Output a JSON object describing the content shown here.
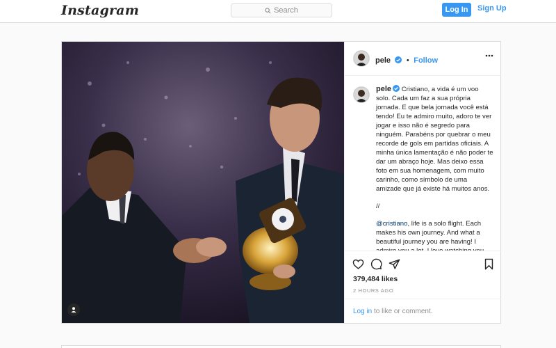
{
  "header": {
    "logo_text": "Instagram",
    "search_placeholder": "Search",
    "login_label": "Log In",
    "signup_label": "Sign Up"
  },
  "post": {
    "username": "pele",
    "follow_label": "Follow",
    "caption_username": "pele",
    "caption_pt": "Cristiano, a vida é um voo solo. Cada um faz a sua própria jornada. E que bela jornada você está tendo! Eu te admiro muito, adoro te ver jogar e isso não é segredo para ninguém. Parabéns por quebrar o meu recorde de gols em partidas oficiais. A minha única lamentação é não poder te dar um abraço hoje. Mas deixo essa foto em sua homenagem, com muito carinho, como símbolo de uma amizade que já existe há muitos anos.",
    "separator": "//",
    "mention": "@cristiano",
    "caption_en": ", life is a solo flight. Each makes his own journey. And what a beautiful journey you are having! I admire you a lot, I love watching you",
    "likes": "379,484 likes",
    "time": "2 HOURS AGO",
    "login_link": "Log in",
    "comment_prompt": " to like or comment."
  },
  "colors": {
    "accent": "#3897f0",
    "border": "#dbdbdb",
    "background": "#fafafa",
    "text": "#262626",
    "muted": "#8e8e8e"
  },
  "icons": [
    "search-icon",
    "verified-badge-icon",
    "more-options-icon",
    "heart-icon",
    "comment-icon",
    "share-icon",
    "bookmark-icon",
    "user-tag-icon"
  ]
}
